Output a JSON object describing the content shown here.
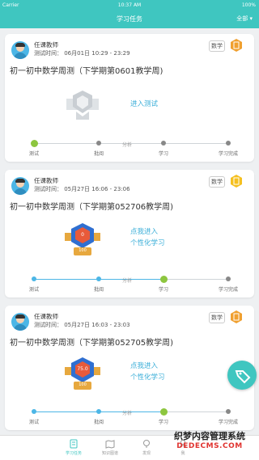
{
  "status_bar": {
    "carrier": "Carrier",
    "time": "10:37 AM",
    "battery": "100%"
  },
  "nav": {
    "title": "学习任务",
    "filter": "全部"
  },
  "cards": [
    {
      "teacher": "任课教师",
      "time": "测试时间：  06月01日 10:29 - 23:29",
      "subject": "数学",
      "title": "初一初中数学周测（下学期第0601教学周)",
      "action": "进入测试",
      "steps": [
        "测试",
        "批阅",
        "学习",
        "学习完成"
      ],
      "mid_label": "分析"
    },
    {
      "teacher": "任课教师",
      "time": "测试时间：  05月27日 16:06 - 23:06",
      "subject": "数学",
      "title": "初一初中数学周测（下学期第052706教学周)",
      "action_line1": "点我进入",
      "action_line2": "个性化学习",
      "medal_score": "0",
      "medal_total": "100",
      "steps": [
        "测试",
        "批阅",
        "学习",
        "学习完成"
      ],
      "mid_label": "分析"
    },
    {
      "teacher": "任课教师",
      "time": "测试时间：  05月27日 16:03 - 23:03",
      "subject": "数学",
      "title": "初一初中数学周测（下学期第052705教学周)",
      "action_line1": "点我进入",
      "action_line2": "个性化学习",
      "medal_score": "75.0",
      "medal_total": "100",
      "steps": [
        "测试",
        "批阅",
        "学习",
        "学习完成"
      ],
      "mid_label": "分析"
    }
  ],
  "tabs": [
    {
      "label": "学习任务",
      "icon": "task-icon"
    },
    {
      "label": "知识图谱",
      "icon": "map-icon"
    },
    {
      "label": "发现",
      "icon": "discover-icon"
    },
    {
      "label": "我",
      "icon": "user-icon"
    }
  ],
  "watermark": {
    "line1": "织梦内容管理系统",
    "line2": "DEDECMS.COM"
  },
  "colors": {
    "primary": "#3fc6c0",
    "accent": "#4cb6e6",
    "badge_orange": "#f0a030",
    "badge_gold": "#f5c020"
  }
}
